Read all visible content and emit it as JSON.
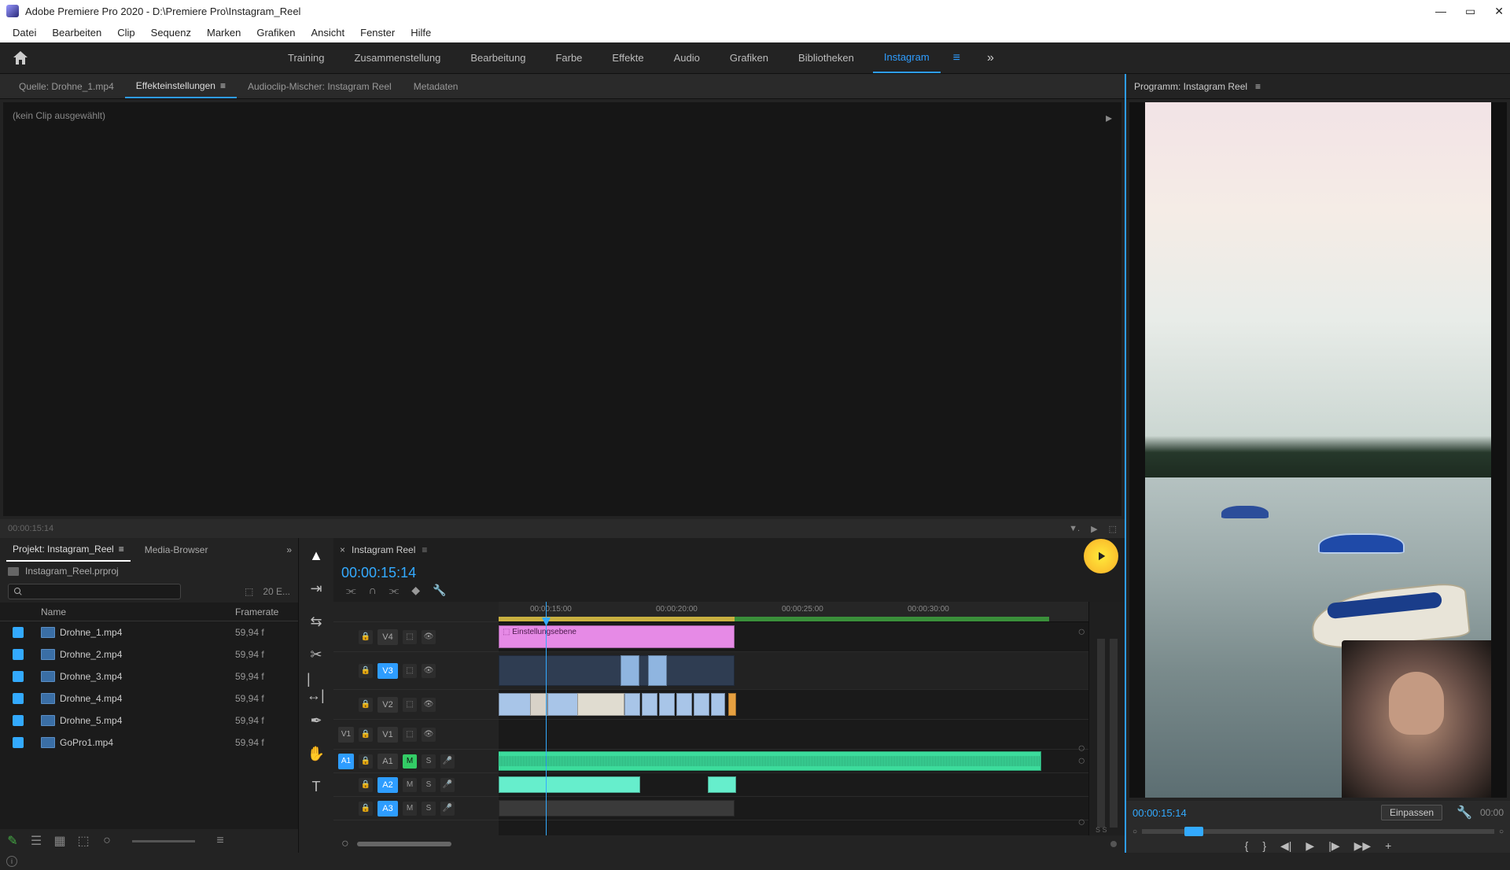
{
  "app": {
    "title": "Adobe Premiere Pro 2020 - D:\\Premiere Pro\\Instagram_Reel"
  },
  "menu": [
    "Datei",
    "Bearbeiten",
    "Clip",
    "Sequenz",
    "Marken",
    "Grafiken",
    "Ansicht",
    "Fenster",
    "Hilfe"
  ],
  "workspaces": [
    "Training",
    "Zusammenstellung",
    "Bearbeitung",
    "Farbe",
    "Effekte",
    "Audio",
    "Grafiken",
    "Bibliotheken",
    "Instagram"
  ],
  "workspace_active": "Instagram",
  "source_tabs": {
    "source": "Quelle: Drohne_1.mp4",
    "effects": "Effekteinstellungen",
    "mixer": "Audioclip-Mischer: Instagram Reel",
    "metadata": "Metadaten"
  },
  "effects_hint": "(kein Clip ausgewählt)",
  "effects_tc": "00:00:15:14",
  "program": {
    "title": "Programm: Instagram Reel",
    "timecode": "00:00:15:14",
    "fit": "Einpassen",
    "duration": "00:00"
  },
  "project": {
    "tab_project": "Projekt: Instagram_Reel",
    "tab_browser": "Media-Browser",
    "path": "Instagram_Reel.prproj",
    "count": "20 E...",
    "cols": {
      "name": "Name",
      "framerate": "Framerate"
    },
    "items": [
      {
        "name": "Drohne_1.mp4",
        "fr": "59,94 f"
      },
      {
        "name": "Drohne_2.mp4",
        "fr": "59,94 f"
      },
      {
        "name": "Drohne_3.mp4",
        "fr": "59,94 f"
      },
      {
        "name": "Drohne_4.mp4",
        "fr": "59,94 f"
      },
      {
        "name": "Drohne_5.mp4",
        "fr": "59,94 f"
      },
      {
        "name": "GoPro1.mp4",
        "fr": "59,94 f"
      }
    ]
  },
  "timeline": {
    "seq_name": "Instagram Reel",
    "timecode": "00:00:15:14",
    "ticks": [
      "00:00:15:00",
      "00:00:20:00",
      "00:00:25:00",
      "00:00:30:00"
    ],
    "tracks": {
      "v4": "V4",
      "v3": "V3",
      "v2": "V2",
      "v1": "V1",
      "a1": "A1",
      "a2": "A2",
      "a3": "A3",
      "mute": "M",
      "solo": "S",
      "v1tgt": "V1",
      "a1tgt": "A1"
    },
    "adjustment_label": "Einstellungsebene",
    "meters_label": "S S"
  }
}
